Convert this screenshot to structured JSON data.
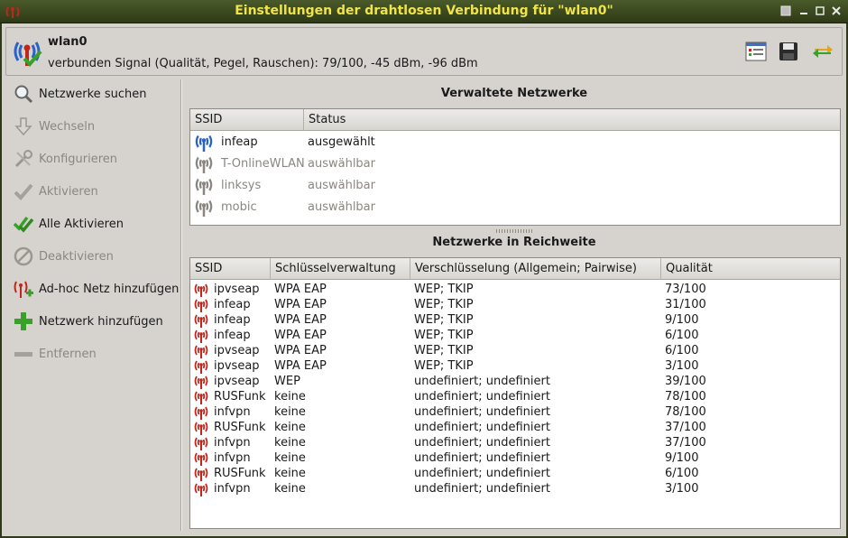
{
  "window": {
    "title": "Einstellungen der drahtlosen Verbindung für \"wlan0\""
  },
  "header": {
    "interface": "wlan0",
    "status": "verbunden  Signal (Qualität, Pegel, Rauschen): 79/100, -45 dBm, -96 dBm"
  },
  "sidebar": {
    "items": [
      {
        "label": "Netzwerke suchen",
        "icon": "magnifier-icon",
        "enabled": true
      },
      {
        "label": "Wechseln",
        "icon": "arrow-down-icon",
        "enabled": false
      },
      {
        "label": "Konfigurieren",
        "icon": "tools-icon",
        "enabled": false
      },
      {
        "label": "Aktivieren",
        "icon": "check-icon",
        "enabled": false
      },
      {
        "label": "Alle Aktivieren",
        "icon": "double-check-icon",
        "enabled": true
      },
      {
        "label": "Deaktivieren",
        "icon": "forbidden-icon",
        "enabled": false
      },
      {
        "label": "Ad-hoc Netz hinzufügen",
        "icon": "adhoc-add-icon",
        "enabled": true
      },
      {
        "label": "Netzwerk hinzufügen",
        "icon": "plus-icon",
        "enabled": true
      },
      {
        "label": "Entfernen",
        "icon": "minus-icon",
        "enabled": false
      }
    ]
  },
  "managed": {
    "title": "Verwaltete Netzwerke",
    "columns": [
      "SSID",
      "Status"
    ],
    "rows": [
      {
        "ssid": "infeap",
        "status": "ausgewählt",
        "active": true
      },
      {
        "ssid": "T-OnlineWLAN",
        "status": "auswählbar",
        "active": false
      },
      {
        "ssid": "linksys",
        "status": "auswählbar",
        "active": false
      },
      {
        "ssid": "mobic",
        "status": "auswählbar",
        "active": false
      }
    ]
  },
  "inrange": {
    "title": "Netzwerke in Reichweite",
    "columns": [
      "SSID",
      "Schlüsselverwaltung",
      "Verschlüsselung (Allgemein; Pairwise)",
      "Qualität"
    ],
    "rows": [
      [
        "ipvseap",
        "WPA EAP",
        "WEP; TKIP",
        "73/100"
      ],
      [
        "infeap",
        "WPA EAP",
        "WEP; TKIP",
        "31/100"
      ],
      [
        "infeap",
        "WPA EAP",
        "WEP; TKIP",
        "9/100"
      ],
      [
        "infeap",
        "WPA EAP",
        "WEP; TKIP",
        "6/100"
      ],
      [
        "ipvseap",
        "WPA EAP",
        "WEP; TKIP",
        "6/100"
      ],
      [
        "ipvseap",
        "WPA EAP",
        "WEP; TKIP",
        "3/100"
      ],
      [
        "ipvseap",
        "WEP",
        "undefiniert; undefiniert",
        "39/100"
      ],
      [
        "RUSFunk",
        "keine",
        "undefiniert; undefiniert",
        "78/100"
      ],
      [
        "infvpn",
        "keine",
        "undefiniert; undefiniert",
        "78/100"
      ],
      [
        "RUSFunk",
        "keine",
        "undefiniert; undefiniert",
        "37/100"
      ],
      [
        "infvpn",
        "keine",
        "undefiniert; undefiniert",
        "37/100"
      ],
      [
        "infvpn",
        "keine",
        "undefiniert; undefiniert",
        "9/100"
      ],
      [
        "RUSFunk",
        "keine",
        "undefiniert; undefiniert",
        "6/100"
      ],
      [
        "infvpn",
        "keine",
        "undefiniert; undefiniert",
        "3/100"
      ]
    ]
  },
  "colors": {
    "titlebar": "#2e3a16",
    "title_text": "#f0e44a",
    "signal_red": "#c0261c",
    "signal_blue": "#2a62c8",
    "signal_grey": "#8a8780"
  }
}
